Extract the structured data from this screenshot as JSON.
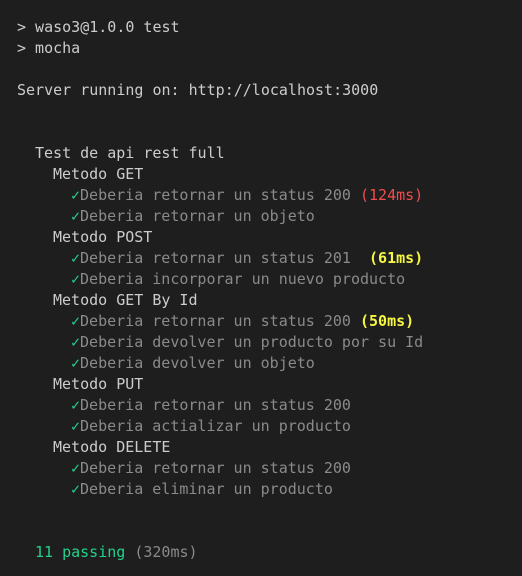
{
  "header": {
    "cmd1": "> waso3@1.0.0 test",
    "cmd2": "> mocha",
    "server": "Server running on: http://localhost:3000"
  },
  "suite": {
    "title": "Test de api rest full",
    "check_glyph": "✓",
    "groups": [
      {
        "name": "Metodo GET",
        "tests": [
          {
            "title": "Deberia retornar un status 200",
            "duration": "(124ms)"
          },
          {
            "title": "Deberia retornar un objeto",
            "duration": ""
          }
        ]
      },
      {
        "name": "Metodo POST",
        "tests": [
          {
            "title": "Deberia retornar un status 201",
            "duration": "(61ms)"
          },
          {
            "title": "Deberia incorporar un nuevo producto",
            "duration": ""
          }
        ]
      },
      {
        "name": "Metodo GET By Id",
        "tests": [
          {
            "title": "Deberia retornar un status 200",
            "duration": "(50ms)"
          },
          {
            "title": "Deberia devolver un producto por su Id",
            "duration": ""
          },
          {
            "title": "Deberia devolver un objeto",
            "duration": ""
          }
        ]
      },
      {
        "name": "Metodo PUT",
        "tests": [
          {
            "title": "Deberia retornar un status 200",
            "duration": ""
          },
          {
            "title": "Deberia actializar un producto",
            "duration": ""
          }
        ]
      },
      {
        "name": "Metodo DELETE",
        "tests": [
          {
            "title": "Deberia retornar un status 200",
            "duration": ""
          },
          {
            "title": "Deberia eliminar un producto",
            "duration": ""
          }
        ]
      }
    ]
  },
  "summary": {
    "passing": "11 passing",
    "total": "(320ms)"
  },
  "colors": {
    "background": "#1e1e1e",
    "pass": "#23d18b",
    "slow": "#f14c4c",
    "medium": "#f5f543"
  }
}
